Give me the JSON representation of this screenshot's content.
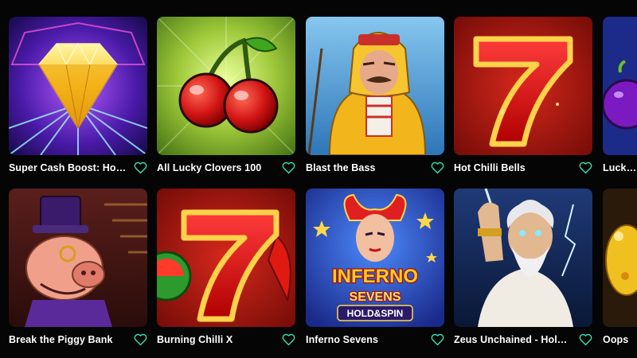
{
  "colors": {
    "background": "#050505",
    "text": "#ffffff",
    "favorite_icon": "#37e0b2"
  },
  "games": [
    {
      "title": "Super Cash Boost: Hold ...",
      "icon": "heart-outline-icon"
    },
    {
      "title": "All Lucky Clovers 100",
      "icon": "heart-outline-icon"
    },
    {
      "title": "Blast the Bass",
      "icon": "heart-outline-icon"
    },
    {
      "title": "Hot Chilli Bells",
      "icon": "heart-outline-icon"
    },
    {
      "title": "Lucky F",
      "icon": "heart-outline-icon"
    },
    {
      "title": "Break the Piggy Bank",
      "icon": "heart-outline-icon"
    },
    {
      "title": "Burning Chilli X",
      "icon": "heart-outline-icon"
    },
    {
      "title": "Inferno Sevens",
      "icon": "heart-outline-icon"
    },
    {
      "title": "Zeus Unchained - Hold &...",
      "icon": "heart-outline-icon"
    },
    {
      "title": "Oops",
      "icon": "heart-outline-icon"
    }
  ],
  "artwork_text": {
    "inferno_line1": "INFERNO",
    "inferno_line2": "SEVENS",
    "inferno_line3": "HOLD&SPIN"
  }
}
